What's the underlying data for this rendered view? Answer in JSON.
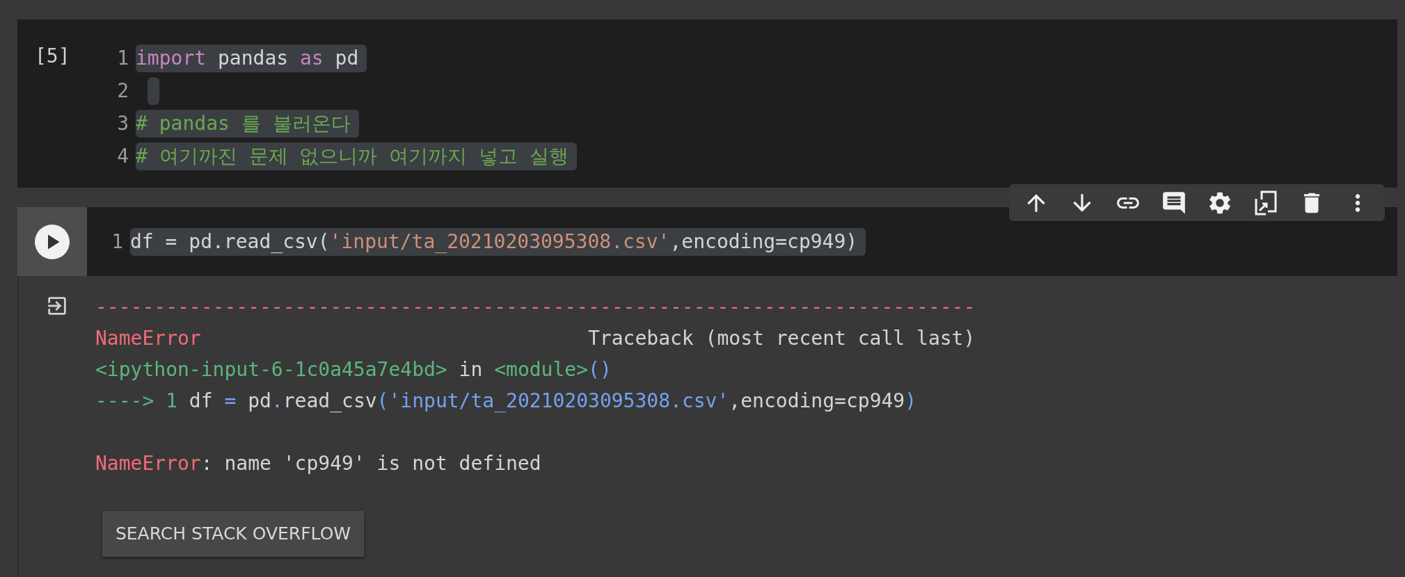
{
  "cell_1": {
    "execution_count": "[5]",
    "lines": [
      {
        "number": "1",
        "tokens": [
          {
            "kind": "keyword",
            "text": "import"
          },
          {
            "kind": "plain",
            "text": " pandas "
          },
          {
            "kind": "keyword",
            "text": "as"
          },
          {
            "kind": "plain",
            "text": " pd"
          }
        ]
      },
      {
        "number": "2"
      },
      {
        "number": "3",
        "tokens": [
          {
            "kind": "comment",
            "text": "# pandas 를 불러온다"
          }
        ]
      },
      {
        "number": "4",
        "tokens": [
          {
            "kind": "comment",
            "text": "# 여기까진 문제 없으니까 여기까지 넣고 실행"
          }
        ]
      }
    ]
  },
  "cell_2": {
    "lines": [
      {
        "number": "1",
        "tokens": [
          {
            "kind": "plain",
            "text": "df = pd.read_csv("
          },
          {
            "kind": "string",
            "text": "'input/ta_20210203095308.csv'"
          },
          {
            "kind": "plain",
            "text": ",encoding=cp949)"
          }
        ]
      }
    ],
    "output": {
      "traceback": [
        {
          "tokens": [
            {
              "kind": "error",
              "text": "---------------------------------------------------------------------------"
            }
          ]
        },
        {
          "tokens": [
            {
              "kind": "error",
              "text": "NameError"
            },
            {
              "kind": "plain",
              "text": "                                 Traceback (most recent call last)"
            }
          ]
        },
        {
          "tokens": [
            {
              "kind": "green",
              "text": "<ipython-input-6-1c0a45a7e4bd>"
            },
            {
              "kind": "plain",
              "text": " in "
            },
            {
              "kind": "green",
              "text": "<module>"
            },
            {
              "kind": "blue",
              "text": "()"
            }
          ]
        },
        {
          "tokens": [
            {
              "kind": "green",
              "text": "----> 1"
            },
            {
              "kind": "plain",
              "text": " df "
            },
            {
              "kind": "blue",
              "text": "="
            },
            {
              "kind": "plain",
              "text": " pd"
            },
            {
              "kind": "blue",
              "text": "."
            },
            {
              "kind": "plain",
              "text": "read_csv"
            },
            {
              "kind": "blue",
              "text": "("
            },
            {
              "kind": "string2",
              "text": "'input/ta_20210203095308.csv'"
            },
            {
              "kind": "plain",
              "text": ",encoding=cp949"
            },
            {
              "kind": "blue",
              "text": ")"
            }
          ]
        }
      ],
      "message": {
        "tokens": [
          {
            "kind": "error",
            "text": "NameError"
          },
          {
            "kind": "plain",
            "text": ": name 'cp949' is not defined"
          }
        ]
      },
      "button": "SEARCH STACK OVERFLOW"
    }
  }
}
